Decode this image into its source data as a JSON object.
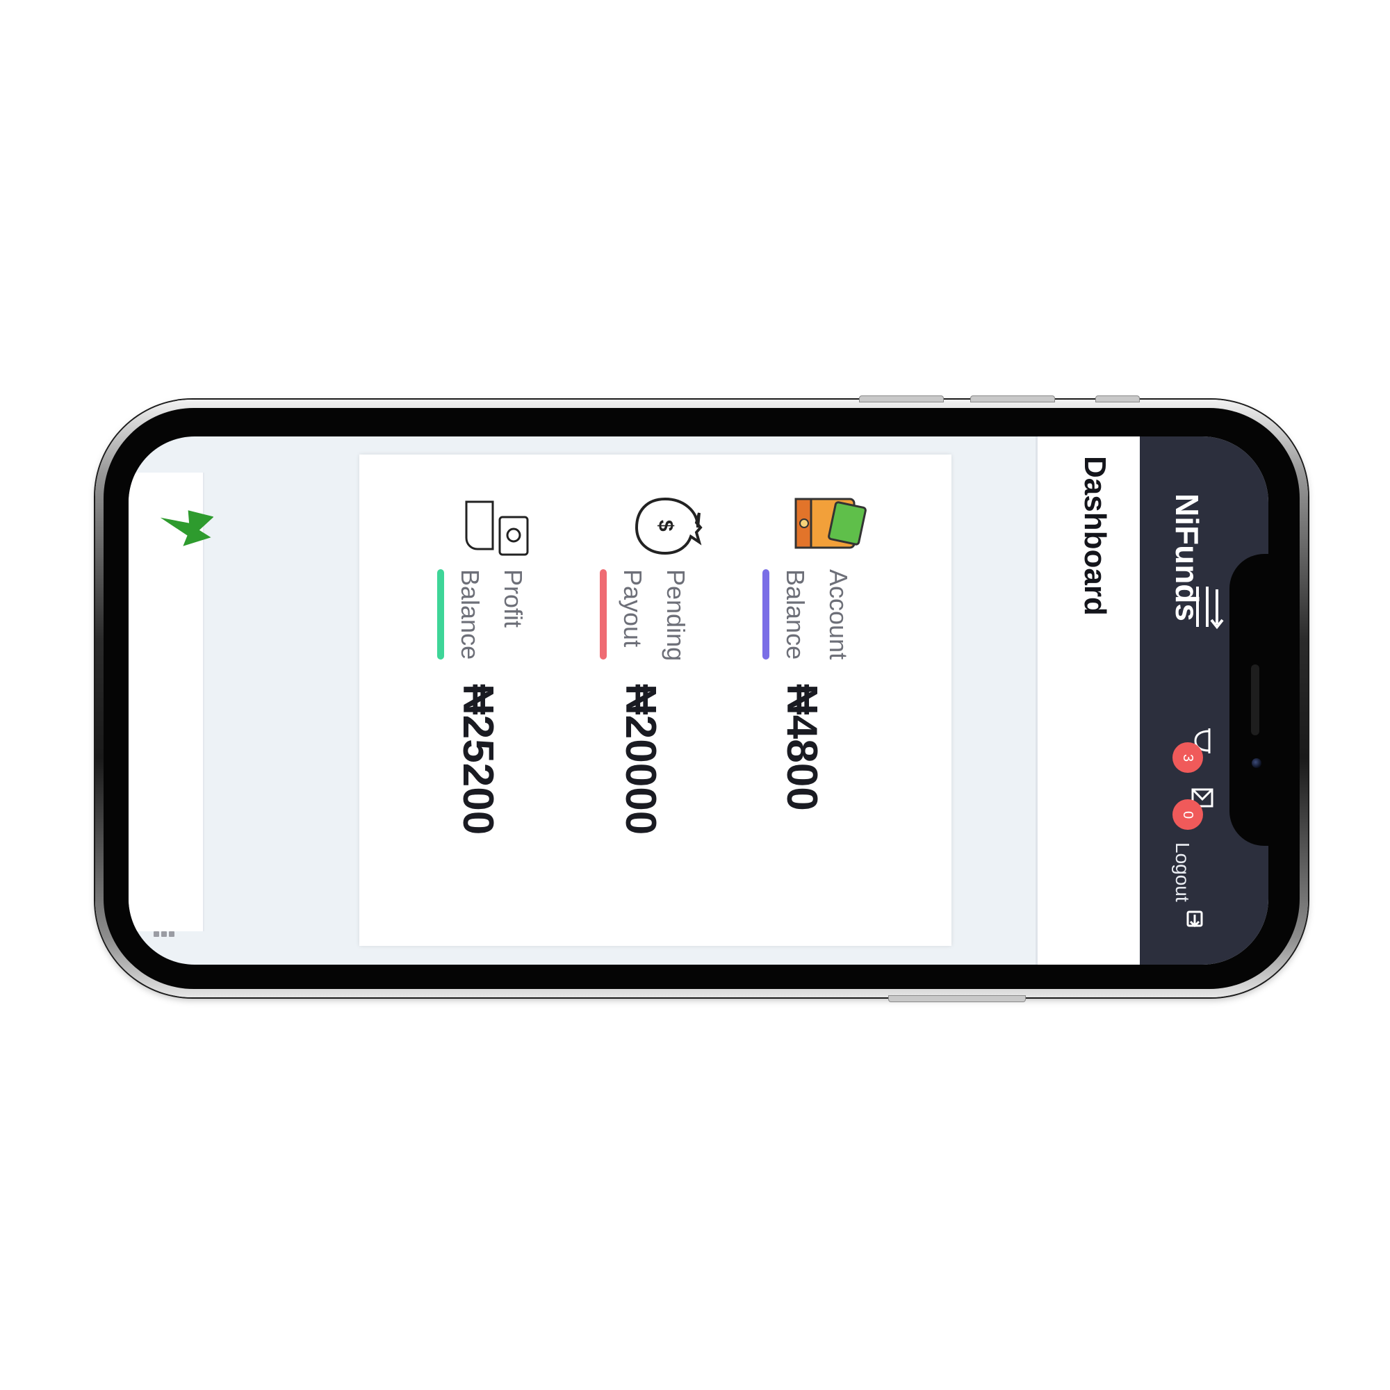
{
  "app": {
    "brand": "NiFunds",
    "page_title": "Dashboard"
  },
  "header": {
    "notifications_count": "3",
    "messages_count": "0",
    "logout_label": "Logout"
  },
  "stats": [
    {
      "label": "Account\nBalance",
      "value": "₦4800",
      "accent": "#7a6ee6",
      "icon": "wallet-icon"
    },
    {
      "label": "Pending\nPayout",
      "value": "₦20000",
      "accent": "#ef6b73",
      "icon": "money-bag-icon"
    },
    {
      "label": "Profit\nBalance",
      "value": "₦25200",
      "accent": "#3ed598",
      "icon": "hand-cash-icon"
    }
  ],
  "colors": {
    "header_bg": "#2c2f3d",
    "badge": "#f05a5a",
    "page_bg": "#edf2f6",
    "bolt": "#2e9b2e"
  }
}
